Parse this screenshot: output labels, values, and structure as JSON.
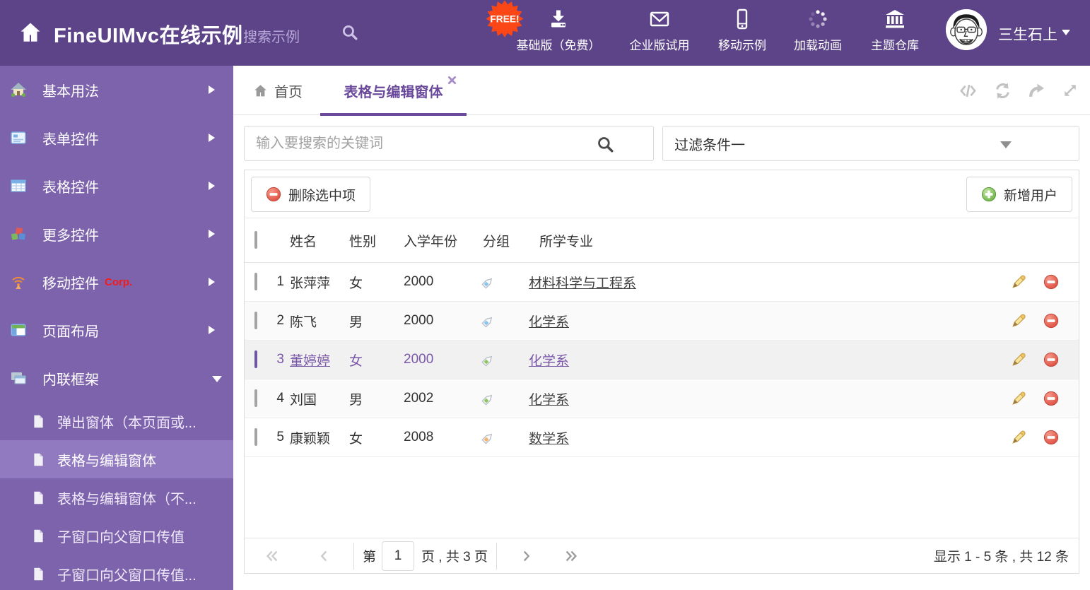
{
  "header": {
    "title": "FineUIMvc在线示例",
    "search_placeholder": "搜索示例",
    "free_badge": "FREE!",
    "nav": [
      {
        "label": "基础版（免费）",
        "icon": "download-icon"
      },
      {
        "label": "企业版试用",
        "icon": "envelope-icon"
      },
      {
        "label": "移动示例",
        "icon": "mobile-icon"
      },
      {
        "label": "加载动画",
        "icon": "spinner-icon"
      },
      {
        "label": "主题仓库",
        "icon": "bank-icon"
      }
    ],
    "username": "三生石上"
  },
  "sidebar": {
    "items": [
      {
        "label": "基本用法",
        "icon": "house-icon"
      },
      {
        "label": "表单控件",
        "icon": "form-icon"
      },
      {
        "label": "表格控件",
        "icon": "table-icon"
      },
      {
        "label": "更多控件",
        "icon": "cubes-icon"
      },
      {
        "label": "移动控件",
        "icon": "signal-icon",
        "badge": "Corp."
      },
      {
        "label": "页面布局",
        "icon": "layout-icon"
      },
      {
        "label": "内联框架",
        "icon": "frames-icon",
        "expanded": true
      }
    ],
    "corp_badge": "Corp.",
    "subitems": [
      "弹出窗体（本页面或...",
      "表格与编辑窗体",
      "表格与编辑窗体（不...",
      "子窗口向父窗口传值",
      "子窗口向父窗口传值..."
    ],
    "selected_subitem": "表格与编辑窗体"
  },
  "tabs": {
    "home_label": "首页",
    "active_label": "表格与编辑窗体"
  },
  "filters": {
    "keyword_placeholder": "输入要搜索的关键词",
    "selected": "过滤条件一"
  },
  "toolbar": {
    "delete_label": "删除选中项",
    "add_label": "新增用户"
  },
  "table": {
    "headers": [
      "姓名",
      "性别",
      "入学年份",
      "分组",
      "所学专业"
    ],
    "rows": [
      {
        "num": "1",
        "name": "张萍萍",
        "gender": "女",
        "year": "2000",
        "tag": "blue",
        "major": "材料科学与工程系",
        "selected": false
      },
      {
        "num": "2",
        "name": "陈飞",
        "gender": "男",
        "year": "2000",
        "tag": "blue",
        "major": "化学系",
        "selected": false
      },
      {
        "num": "3",
        "name": "董婷婷",
        "gender": "女",
        "year": "2000",
        "tag": "green",
        "major": "化学系",
        "selected": true
      },
      {
        "num": "4",
        "name": "刘国",
        "gender": "男",
        "year": "2002",
        "tag": "green",
        "major": "化学系",
        "selected": false
      },
      {
        "num": "5",
        "name": "康颖颖",
        "gender": "女",
        "year": "2008",
        "tag": "orange",
        "major": "数学系",
        "selected": false
      }
    ]
  },
  "pagination": {
    "prefix": "第",
    "page": "1",
    "suffix": "页 , 共 3 页",
    "summary": "显示 1 - 5 条 , 共 12 条"
  },
  "colors": {
    "header_bg": "#5d4489",
    "sidebar_bg": "#7d62ac",
    "sidebar_selected": "#927ac1",
    "accent": "#6b4a9c",
    "free_badge": "#fb4716",
    "selected_text": "#7a57a8",
    "tag_blue": "#85c6f0",
    "tag_green": "#8fc75f",
    "tag_orange": "#f8b06a"
  }
}
